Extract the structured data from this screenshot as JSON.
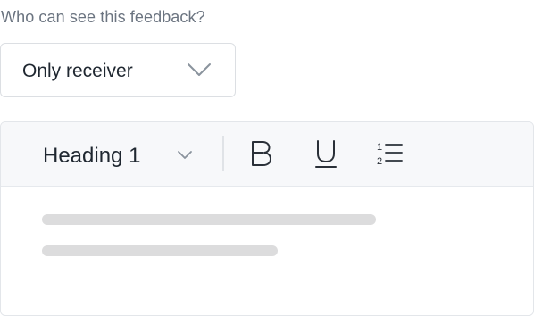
{
  "visibility": {
    "label": "Who can see this feedback?",
    "selected": "Only receiver",
    "icon": "chevron-down-icon"
  },
  "editor": {
    "block_style": {
      "selected": "Heading 1",
      "icon": "chevron-down-icon"
    },
    "tools": [
      {
        "name": "bold",
        "icon": "bold-icon"
      },
      {
        "name": "underline",
        "icon": "underline-icon"
      },
      {
        "name": "ordered-list",
        "icon": "ordered-list-icon"
      }
    ],
    "body_state": "loading-placeholder",
    "colors": {
      "toolbar_bg": "#f7f8fa",
      "border": "#e3e6ea",
      "skeleton": "#dcdcdd",
      "text": "#1f2730",
      "muted_text": "#6b7480"
    }
  }
}
